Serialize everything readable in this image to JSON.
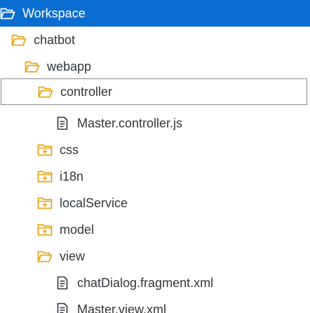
{
  "colors": {
    "selection_bg": "#0a6ed1",
    "folder_icon": "#e9a519",
    "text": "#32363a",
    "file_icon": "#32363a"
  },
  "tree": {
    "items": [
      {
        "label": "Workspace",
        "icon": "folder-open-icon",
        "depth": 0,
        "selected": true
      },
      {
        "label": "chatbot",
        "icon": "folder-open-icon",
        "depth": 1
      },
      {
        "label": "webapp",
        "icon": "folder-open-icon",
        "depth": 2
      },
      {
        "label": "controller",
        "icon": "folder-open-icon",
        "depth": 3,
        "focused": true
      },
      {
        "label": "Master.controller.js",
        "icon": "file-icon",
        "depth": 4
      },
      {
        "label": "css",
        "icon": "folder-closed-icon",
        "depth": 3
      },
      {
        "label": "i18n",
        "icon": "folder-closed-icon",
        "depth": 3
      },
      {
        "label": "localService",
        "icon": "folder-closed-icon",
        "depth": 3
      },
      {
        "label": "model",
        "icon": "folder-closed-icon",
        "depth": 3
      },
      {
        "label": "view",
        "icon": "folder-open-icon",
        "depth": 3
      },
      {
        "label": "chatDialog.fragment.xml",
        "icon": "file-icon",
        "depth": 4
      },
      {
        "label": "Master.view.xml",
        "icon": "file-icon",
        "depth": 4
      }
    ]
  }
}
